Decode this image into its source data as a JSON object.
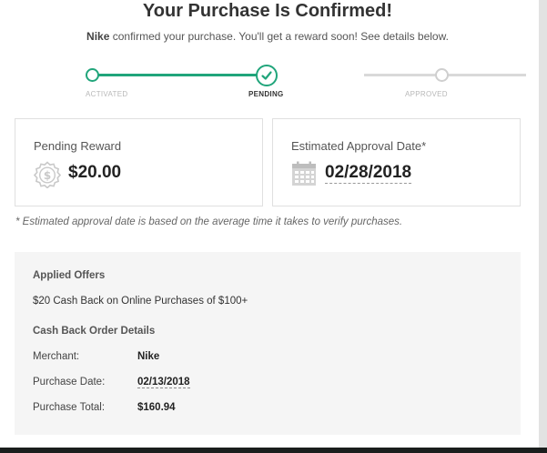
{
  "header": {
    "title": "Your Purchase Is Confirmed!",
    "merchant_name": "Nike",
    "subtitle_rest": "confirmed your purchase. You'll get a reward soon! See details below."
  },
  "stepper": {
    "steps": [
      {
        "label": "ACTIVATED",
        "state": "done"
      },
      {
        "label": "PENDING",
        "state": "current"
      },
      {
        "label": "APPROVED",
        "state": "todo"
      }
    ],
    "accent_color": "#21a57b"
  },
  "reward_card": {
    "label": "Pending Reward",
    "value": "$20.00",
    "icon": "dollar-badge-icon"
  },
  "approval_card": {
    "label": "Estimated Approval Date*",
    "value": "02/28/2018",
    "icon": "calendar-icon"
  },
  "note": "* Estimated approval date is based on the average time it takes to verify purchases.",
  "details": {
    "offers_title": "Applied Offers",
    "offer_text": "$20 Cash Back on Online Purchases of $100+",
    "order_title": "Cash Back Order Details",
    "rows": [
      {
        "label": "Merchant:",
        "value": "Nike"
      },
      {
        "label": "Purchase Date:",
        "value": "02/13/2018"
      },
      {
        "label": "Purchase Total:",
        "value": "$160.94"
      }
    ]
  }
}
